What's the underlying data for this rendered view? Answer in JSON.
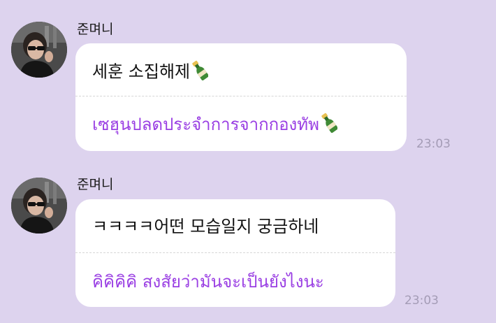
{
  "colors": {
    "background": "#ddd3ee",
    "bubble": "#ffffff",
    "translated_text": "#9a3fe3",
    "time_text": "#a49cb6"
  },
  "messages": [
    {
      "sender": "준며니",
      "avatar_icon": "profile-photo-avatar",
      "original_text": "세훈 소집해제",
      "original_emoji": "champagne-bottle-icon",
      "translated_text": "เซฮุนปลดประจำการจากกองทัพ",
      "translated_emoji": "champagne-bottle-icon",
      "time": "23:03"
    },
    {
      "sender": "준며니",
      "avatar_icon": "profile-photo-avatar",
      "original_text": "ㅋㅋㅋㅋ어떤 모습일지 궁금하네",
      "translated_text": "คิคิคิคิ สงสัยว่ามันจะเป็นยังไงนะ",
      "time": "23:03"
    }
  ]
}
